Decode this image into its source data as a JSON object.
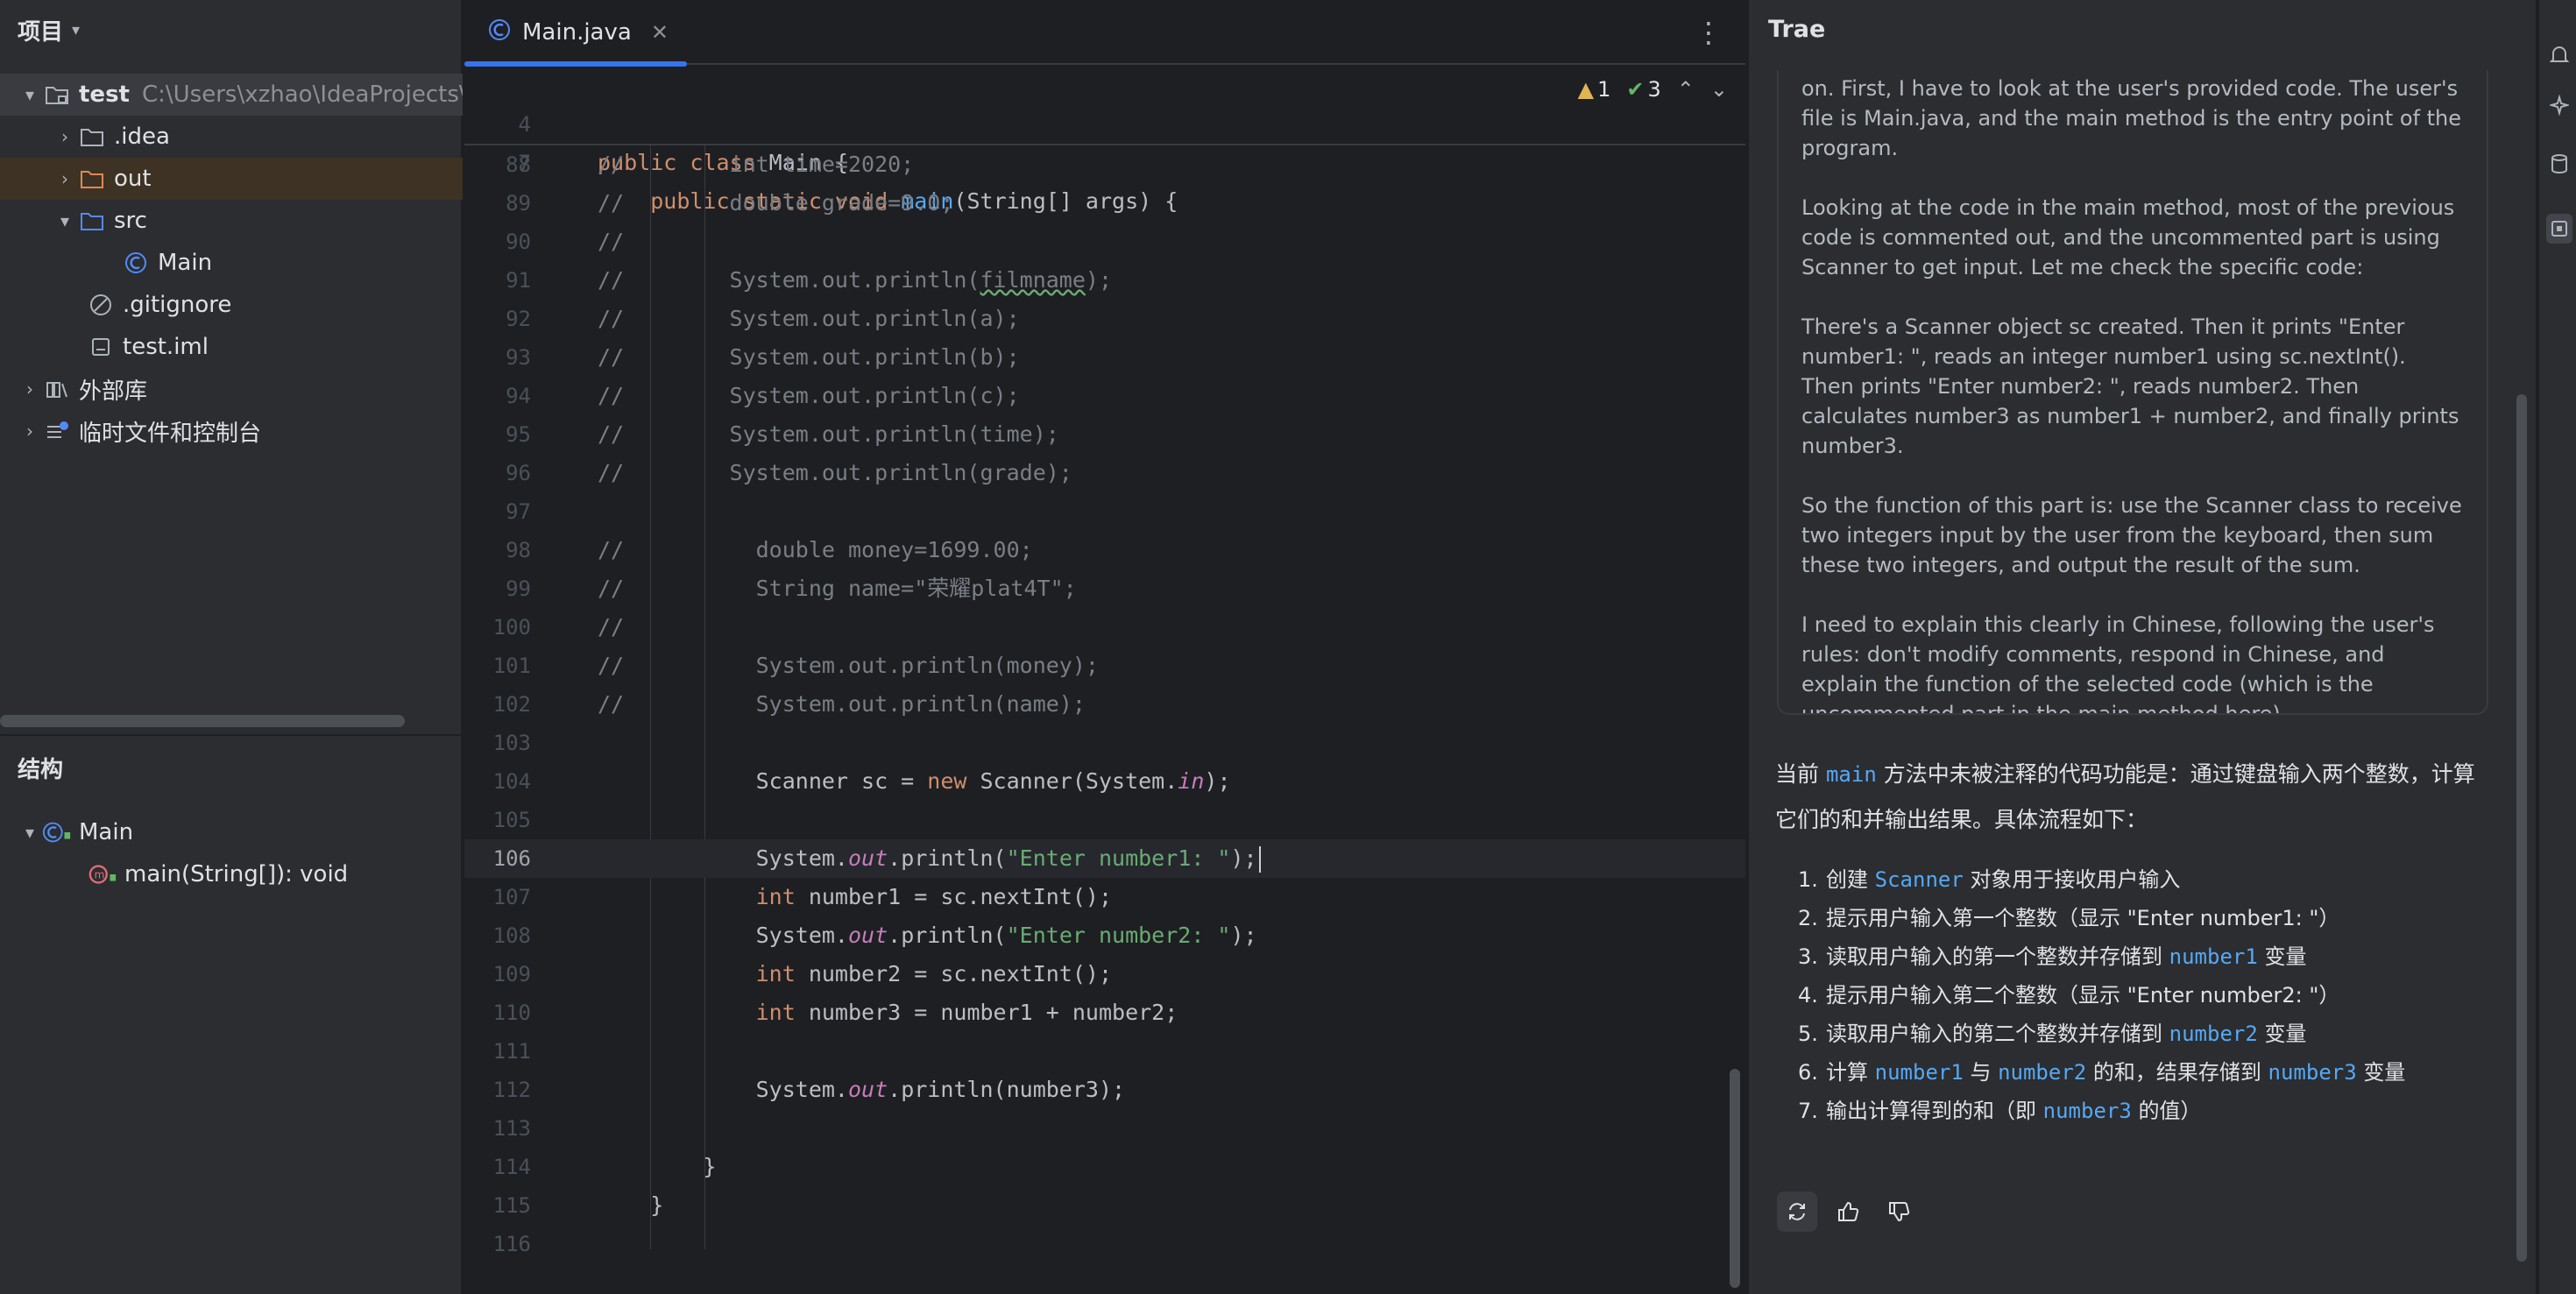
{
  "project_panel": {
    "title": "项目",
    "tree": [
      {
        "label": "test",
        "path": "C:\\Users\\xzhao\\IdeaProjects\\test",
        "icon": "module-folder-icon"
      },
      {
        "label": ".idea",
        "icon": "folder-icon"
      },
      {
        "label": "out",
        "icon": "folder-icon"
      },
      {
        "label": "src",
        "icon": "source-folder-icon"
      },
      {
        "label": "Main",
        "icon": "java-class-icon"
      },
      {
        "label": ".gitignore",
        "icon": "ignore-file-icon"
      },
      {
        "label": "test.iml",
        "icon": "iml-file-icon"
      },
      {
        "label": "外部库",
        "icon": "library-icon"
      },
      {
        "label": "临时文件和控制台",
        "icon": "scratch-icon"
      }
    ],
    "structure_title": "结构",
    "structure_items": [
      {
        "label": "Main",
        "icon": "java-class-icon"
      },
      {
        "label": "main(String[]): void",
        "icon": "method-icon"
      }
    ]
  },
  "editor": {
    "tab_label": "Main.java",
    "sticky_lines": [
      {
        "num": "4",
        "text": "public class Main {"
      },
      {
        "num": "7",
        "text": "    public static void main(String[] args) {"
      }
    ],
    "warnings_count": "1",
    "checks_count": "3",
    "lines": [
      {
        "num": "88",
        "text": "//        int time=2020;"
      },
      {
        "num": "89",
        "text": "//        double grade=9.0;"
      },
      {
        "num": "90",
        "text": "//"
      },
      {
        "num": "91",
        "text": "//        System.out.println(filmname);"
      },
      {
        "num": "92",
        "text": "//        System.out.println(a);"
      },
      {
        "num": "93",
        "text": "//        System.out.println(b);"
      },
      {
        "num": "94",
        "text": "//        System.out.println(c);"
      },
      {
        "num": "95",
        "text": "//        System.out.println(time);"
      },
      {
        "num": "96",
        "text": "//        System.out.println(grade);"
      },
      {
        "num": "97",
        "text": ""
      },
      {
        "num": "98",
        "text": "//          double money=1699.00;"
      },
      {
        "num": "99",
        "text": "//          String name=\"荣耀plat4T\";"
      },
      {
        "num": "100",
        "text": "//"
      },
      {
        "num": "101",
        "text": "//          System.out.println(money);"
      },
      {
        "num": "102",
        "text": "//          System.out.println(name);"
      },
      {
        "num": "103",
        "text": ""
      },
      {
        "num": "104",
        "text": "            Scanner sc = new Scanner(System.in);"
      },
      {
        "num": "105",
        "text": ""
      },
      {
        "num": "106",
        "text": "            System.out.println(\"Enter number1: \");"
      },
      {
        "num": "107",
        "text": "            int number1 = sc.nextInt();"
      },
      {
        "num": "108",
        "text": "            System.out.println(\"Enter number2: \");"
      },
      {
        "num": "109",
        "text": "            int number2 = sc.nextInt();"
      },
      {
        "num": "110",
        "text": "            int number3 = number1 + number2;"
      },
      {
        "num": "111",
        "text": ""
      },
      {
        "num": "112",
        "text": "            System.out.println(number3);"
      },
      {
        "num": "113",
        "text": ""
      },
      {
        "num": "114",
        "text": "        }"
      },
      {
        "num": "115",
        "text": "    }"
      },
      {
        "num": "116",
        "text": ""
      }
    ]
  },
  "trae": {
    "title": "Trae",
    "thought_paragraphs": [
      "on. First, I have to look at the user's provided code. The user's file is Main.java, and the main method is the entry point of the program.",
      "Looking at the code in the main method, most of the previous code is commented out, and the uncommented part is using Scanner to get input. Let me check the specific code:",
      "There's a Scanner object sc created. Then it prints \"Enter number1: \", reads an integer number1 using sc.nextInt(). Then prints \"Enter number2: \", reads number2. Then calculates number3 as number1 + number2, and finally prints number3.",
      "So the function of this part is: use the Scanner class to receive two integers input by the user from the keyboard, then sum these two integers, and output the result of the sum.",
      "I need to explain this clearly in Chinese, following the user's rules: don't modify comments, respond in Chinese, and explain the function of the selected code (which is the uncommented part in the main method here)."
    ],
    "answer_intro_pre": "当前",
    "answer_intro_code": "main",
    "answer_intro_post": "方法中未被注释的代码功能是：通过键盘输入两个整数，计算它们的和并输出结果。具体流程如下：",
    "steps": [
      {
        "num": "1.",
        "pre": "创建",
        "code": "Scanner",
        "post": "对象用于接收用户输入"
      },
      {
        "num": "2.",
        "pre": "提示用户输入第一个整数（显示 \"Enter number1: \"）",
        "code": "",
        "post": ""
      },
      {
        "num": "3.",
        "pre": "读取用户输入的第一个整数并存储到",
        "code": "number1",
        "post": "变量"
      },
      {
        "num": "4.",
        "pre": "提示用户输入第二个整数（显示 \"Enter number2: \"）",
        "code": "",
        "post": ""
      },
      {
        "num": "5.",
        "pre": "读取用户输入的第二个整数并存储到",
        "code": "number2",
        "post": "变量"
      },
      {
        "num": "6.",
        "pre": "计算",
        "code": "number1",
        "mid": "与",
        "code2": "number2",
        "mid2": "的和，结果存储到",
        "code3": "number3",
        "post": "变量"
      },
      {
        "num": "7.",
        "pre": "输出计算得到的和（即",
        "code": "number3",
        "post": "的值）"
      }
    ]
  }
}
